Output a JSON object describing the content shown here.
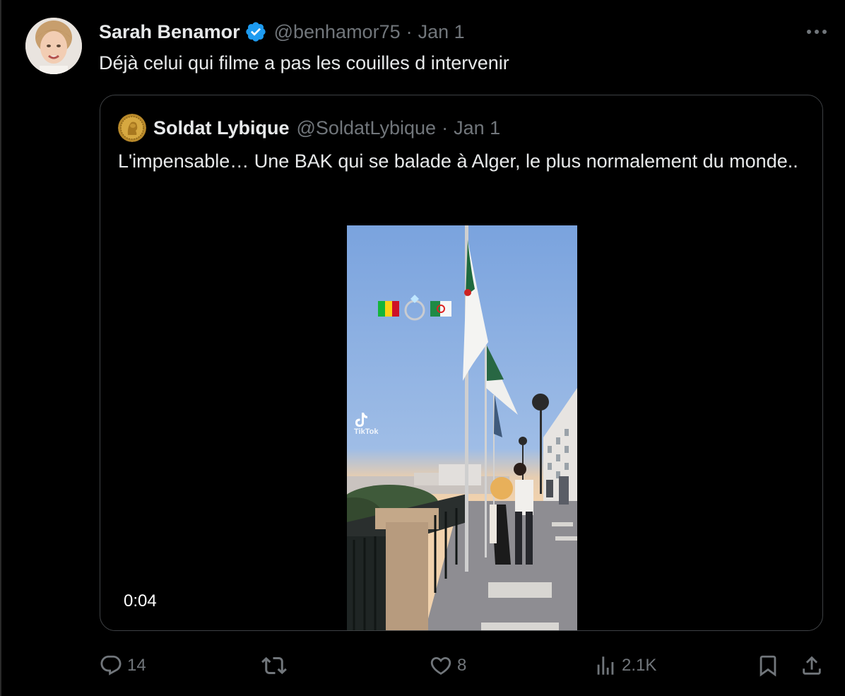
{
  "tweet": {
    "author": {
      "name": "Sarah Benamor",
      "handle": "@benhamor75",
      "separator": "·",
      "date": "Jan 1"
    },
    "text": "Déjà celui qui filme a pas les couilles d intervenir",
    "more_icon": "more-horizontal-icon"
  },
  "quote": {
    "author": {
      "name": "Soldat Lybique",
      "handle": "@SoldatLybique",
      "separator": "·",
      "date": "Jan 1"
    },
    "text": "L'impensable… Une BAK qui se balade à Alger, le plus normalement du monde..",
    "video": {
      "duration": "0:04",
      "overlay_emoji": "🇲🇱💍🇩🇿",
      "watermark": "TikTok"
    }
  },
  "actions": {
    "replies": "14",
    "retweets": "",
    "likes": "8",
    "views": "2.1K"
  },
  "colors": {
    "background": "#000000",
    "text_primary": "#e7e9ea",
    "text_secondary": "#71767b",
    "border": "#3e4144",
    "verified": "#1d9bf0"
  }
}
